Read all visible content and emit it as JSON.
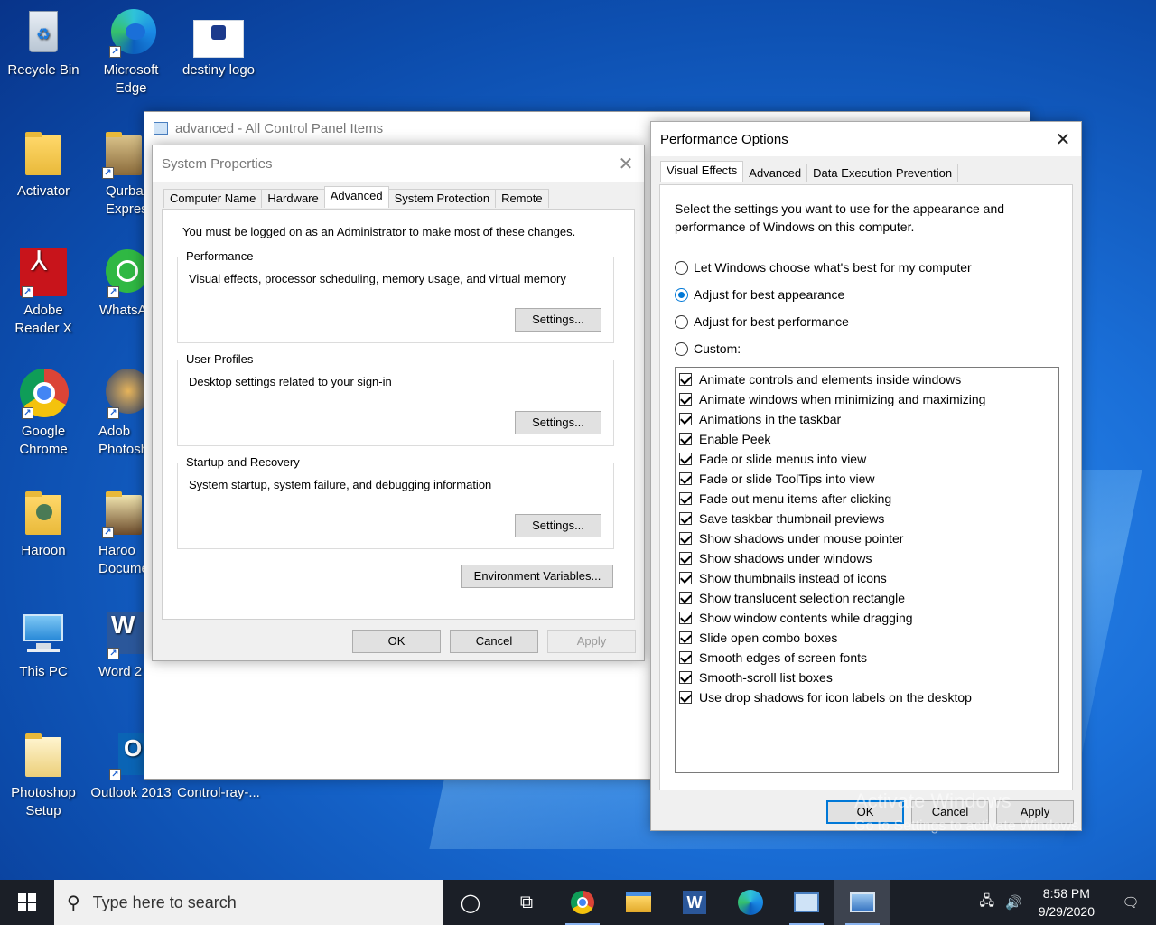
{
  "desktop": {
    "icons": [
      {
        "label": "Recycle Bin"
      },
      {
        "label": "Microsoft Edge"
      },
      {
        "label": "destiny logo"
      },
      {
        "label": "Activator"
      },
      {
        "label": "Qurba Expres"
      },
      {
        "label": "Adobe Reader X"
      },
      {
        "label": "WhatsA"
      },
      {
        "label": "Google Chrome"
      },
      {
        "label": "Adob Photosh"
      },
      {
        "label": "Haroon"
      },
      {
        "label": "Haroo Docume"
      },
      {
        "label": "This PC"
      },
      {
        "label": "Word 2"
      },
      {
        "label": "Photoshop Setup"
      },
      {
        "label": "Outlook 2013"
      },
      {
        "label": "Control-ray-..."
      }
    ]
  },
  "control_panel": {
    "title": "advanced - All Control Panel Items"
  },
  "system_properties": {
    "title": "System Properties",
    "tabs": [
      "Computer Name",
      "Hardware",
      "Advanced",
      "System Protection",
      "Remote"
    ],
    "admin_note": "You must be logged on as an Administrator to make most of these changes.",
    "groups": [
      {
        "label": "Performance",
        "desc": "Visual effects, processor scheduling, memory usage, and virtual memory",
        "button": "Settings..."
      },
      {
        "label": "User Profiles",
        "desc": "Desktop settings related to your sign-in",
        "button": "Settings..."
      },
      {
        "label": "Startup and Recovery",
        "desc": "System startup, system failure, and debugging information",
        "button": "Settings..."
      }
    ],
    "env_button": "Environment Variables...",
    "ok": "OK",
    "cancel": "Cancel",
    "apply": "Apply"
  },
  "performance_options": {
    "title": "Performance Options",
    "tabs": [
      "Visual Effects",
      "Advanced",
      "Data Execution Prevention"
    ],
    "intro": "Select the settings you want to use for the appearance and performance of Windows on this computer.",
    "radios": [
      {
        "label": "Let Windows choose what's best for my computer",
        "selected": false
      },
      {
        "label": "Adjust for best appearance",
        "selected": true
      },
      {
        "label": "Adjust for best performance",
        "selected": false
      },
      {
        "label": "Custom:",
        "selected": false
      }
    ],
    "checkboxes": [
      {
        "label": "Animate controls and elements inside windows",
        "checked": true
      },
      {
        "label": "Animate windows when minimizing and maximizing",
        "checked": true
      },
      {
        "label": "Animations in the taskbar",
        "checked": true
      },
      {
        "label": "Enable Peek",
        "checked": true
      },
      {
        "label": "Fade or slide menus into view",
        "checked": true
      },
      {
        "label": "Fade or slide ToolTips into view",
        "checked": true
      },
      {
        "label": "Fade out menu items after clicking",
        "checked": true
      },
      {
        "label": "Save taskbar thumbnail previews",
        "checked": true
      },
      {
        "label": "Show shadows under mouse pointer",
        "checked": true
      },
      {
        "label": "Show shadows under windows",
        "checked": true
      },
      {
        "label": "Show thumbnails instead of icons",
        "checked": true
      },
      {
        "label": "Show translucent selection rectangle",
        "checked": true
      },
      {
        "label": "Show window contents while dragging",
        "checked": true
      },
      {
        "label": "Slide open combo boxes",
        "checked": true
      },
      {
        "label": "Smooth edges of screen fonts",
        "checked": true
      },
      {
        "label": "Smooth-scroll list boxes",
        "checked": true
      },
      {
        "label": "Use drop shadows for icon labels on the desktop",
        "checked": true
      }
    ],
    "ok": "OK",
    "cancel": "Cancel",
    "apply": "Apply"
  },
  "watermark": {
    "line1": "Activate Windows",
    "line2": "Go to Settings to activate Windows."
  },
  "taskbar": {
    "search_placeholder": "Type here to search",
    "time": "8:58 PM",
    "date": "9/29/2020"
  }
}
